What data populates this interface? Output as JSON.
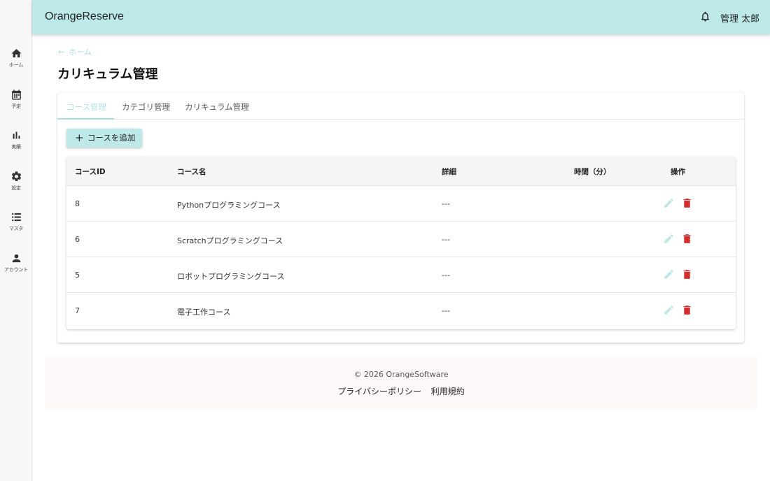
{
  "app": {
    "title": "OrangeReserve",
    "user_name": "管理 太郎"
  },
  "sidebar": {
    "items": [
      {
        "label": "ホーム",
        "icon": "home-icon"
      },
      {
        "label": "予定",
        "icon": "calendar-icon"
      },
      {
        "label": "実績",
        "icon": "bar-chart-icon"
      },
      {
        "label": "設定",
        "icon": "gear-icon"
      },
      {
        "label": "マスタ",
        "icon": "list-icon"
      },
      {
        "label": "アカウント",
        "icon": "person-icon"
      }
    ]
  },
  "breadcrumb": {
    "label": "ホーム"
  },
  "page": {
    "title": "カリキュラム管理"
  },
  "tabs": [
    {
      "label": "コース管理",
      "active": true
    },
    {
      "label": "カテゴリ管理",
      "active": false
    },
    {
      "label": "カリキュラム管理",
      "active": false
    }
  ],
  "actions": {
    "add_label": "コースを追加"
  },
  "table": {
    "headers": [
      "コースID",
      "コース名",
      "詳細",
      "時間（分）",
      "操作"
    ],
    "rows": [
      {
        "id": "8",
        "name": "Pythonプログラミングコース",
        "detail": "---",
        "time": ""
      },
      {
        "id": "6",
        "name": "Scratchプログラミングコース",
        "detail": "---",
        "time": ""
      },
      {
        "id": "5",
        "name": "ロボットプログラミングコース",
        "detail": "---",
        "time": ""
      },
      {
        "id": "7",
        "name": "電子工作コース",
        "detail": "---",
        "time": ""
      }
    ]
  },
  "footer": {
    "copyright": "© 2026 OrangeSoftware",
    "links": [
      "プライバシーポリシー",
      "利用規約"
    ]
  },
  "colors": {
    "header": "#bde9e9",
    "accent": "#a8dede",
    "delete": "#d32f2f",
    "footer_bg": "#fff8f8"
  }
}
